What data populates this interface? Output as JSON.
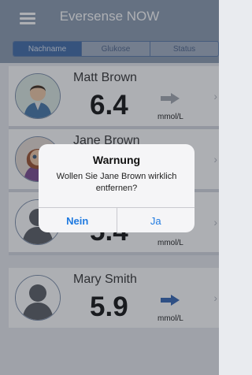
{
  "header": {
    "title": "Eversense NOW",
    "menu_icon": "hamburger-menu-icon"
  },
  "tabs": [
    {
      "label": "Nachname",
      "active": true
    },
    {
      "label": "Glukose",
      "active": false
    },
    {
      "label": "Status",
      "active": false
    }
  ],
  "patients": [
    {
      "name": "Matt Brown",
      "value": "6.4",
      "unit": "mmol/L",
      "trend": "right-arrow-icon",
      "trend_color": "#a4a8b0"
    },
    {
      "name": "Jane Brown",
      "value": "",
      "unit": "",
      "trend": "",
      "trend_color": "#3567b5"
    },
    {
      "name": "",
      "value": "5.4",
      "unit": "mmol/L",
      "trend": "right-arrow-icon",
      "trend_color": "#3567b5"
    },
    {
      "name": "Mary Smith",
      "value": "5.9",
      "unit": "mmol/L",
      "trend": "right-arrow-icon",
      "trend_color": "#3567b5"
    }
  ],
  "dialog": {
    "title": "Warnung",
    "message": "Wollen Sie Jane Brown wirklich entfernen?",
    "cancel_label": "Nein",
    "confirm_label": "Ja"
  },
  "colors": {
    "accent": "#3f6ba8",
    "header": "#8c9bb0",
    "link": "#1f7ae0"
  }
}
